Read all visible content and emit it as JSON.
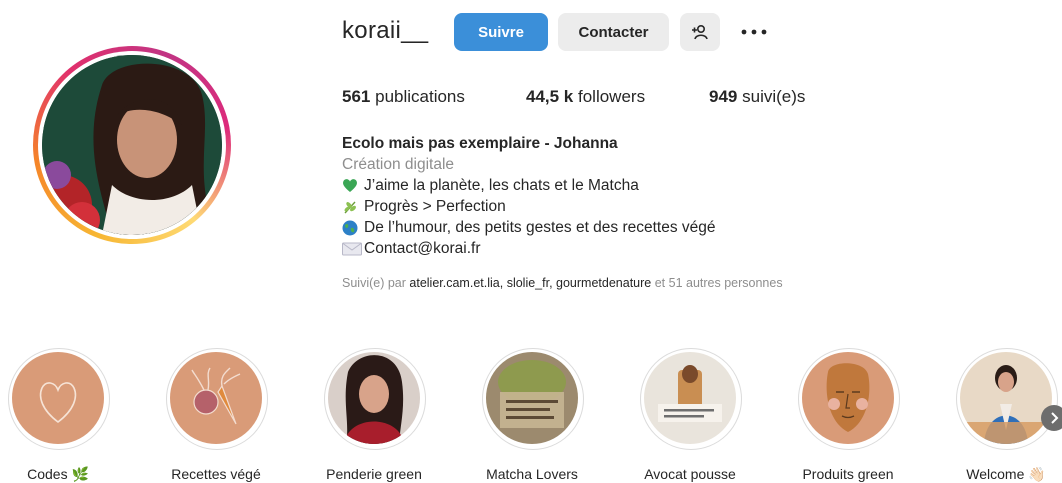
{
  "profile": {
    "username": "koraii__",
    "follow_label": "Suivre",
    "contact_label": "Contacter",
    "stats": {
      "posts_count": "561",
      "posts_label": "publications",
      "followers_count": "44,5 k",
      "followers_label": "followers",
      "following_count": "949",
      "following_label": "suivi(e)s"
    },
    "bio": {
      "name": "Ecolo mais pas exemplaire - Johanna",
      "category": "Création digitale",
      "lines": [
        "J’aime la planète, les chats et le Matcha",
        "Progrès > Perfection",
        "De l’humour, des petits gestes et des recettes végé",
        "Contact@korai.fr"
      ]
    },
    "followed_by": {
      "prefix": "Suivi(e) par",
      "accounts": [
        "atelier.cam.et.lia,",
        "slolie_fr,",
        "gourmetdenature"
      ],
      "suffix": "et 51 autres personnes"
    }
  },
  "highlights": [
    {
      "label": "Codes 🌿"
    },
    {
      "label": "Recettes végé"
    },
    {
      "label": "Penderie green"
    },
    {
      "label": "Matcha Lovers"
    },
    {
      "label": "Avocat pousse"
    },
    {
      "label": "Produits green"
    },
    {
      "label": "Welcome 👋🏻"
    }
  ],
  "icons": {
    "more": "more-options-icon",
    "suggest": "person-add-icon",
    "heart": "green-heart-icon",
    "herb": "herb-icon",
    "globe": "globe-icon",
    "mail": "envelope-icon",
    "next": "chevron-right-icon"
  },
  "colors": {
    "follow_button": "#3b8fd9",
    "secondary_button": "#ececec",
    "highlight_peach": "#d99b78"
  }
}
